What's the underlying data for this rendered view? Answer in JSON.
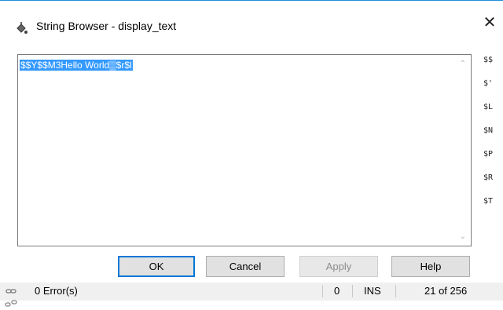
{
  "window": {
    "title": "String Browser - display_text",
    "close_symbol": "✕"
  },
  "editor": {
    "text": "$$Y$$M3Hello World▒$r$l"
  },
  "side_codes": [
    "$$",
    "$'",
    "$L",
    "$N",
    "$P",
    "$R",
    "$T"
  ],
  "buttons": {
    "ok": "OK",
    "cancel": "Cancel",
    "apply": "Apply",
    "help": "Help"
  },
  "status": {
    "errors": "0 Error(s)",
    "column": "0",
    "mode": "INS",
    "count": "21 of 256"
  },
  "icons": {
    "app": "paint-bucket-icon",
    "status_left": "link-icon",
    "status_right": "unlink-icon"
  },
  "colors": {
    "selection": "#3399ff",
    "accent": "#0078d7"
  }
}
